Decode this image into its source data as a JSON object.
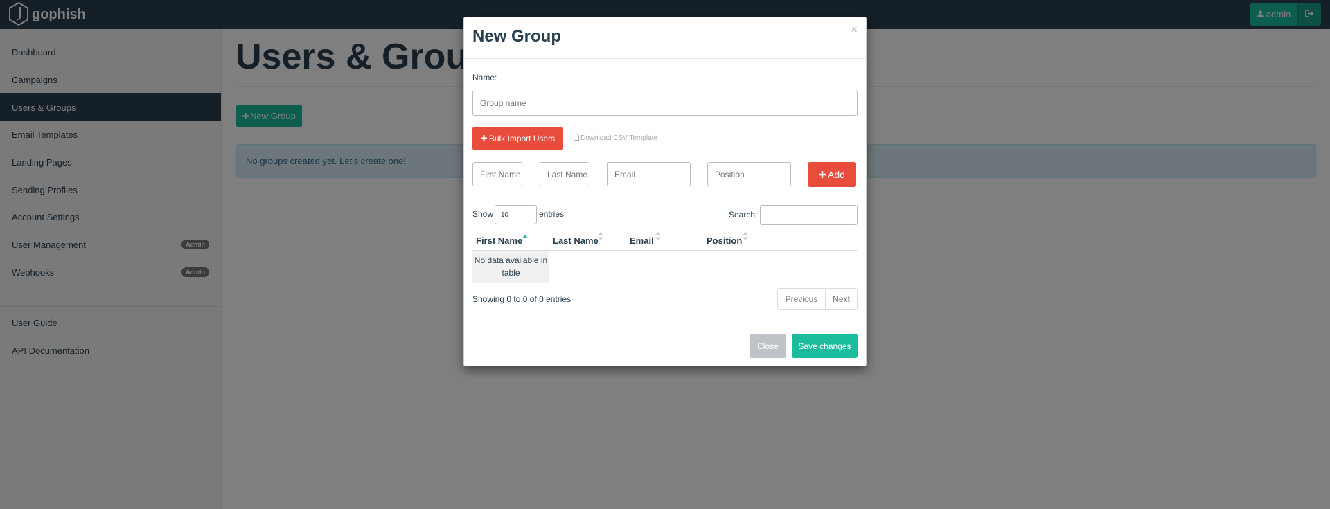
{
  "navbar": {
    "brand": "gophish",
    "user_label": "admin",
    "icons": {
      "logo": "gophish-hexagon-icon",
      "user": "user-icon",
      "logout": "sign-out-icon"
    }
  },
  "sidebar": {
    "items": [
      {
        "label": "Dashboard"
      },
      {
        "label": "Campaigns"
      },
      {
        "label": "Users & Groups",
        "active": true
      },
      {
        "label": "Email Templates"
      },
      {
        "label": "Landing Pages"
      },
      {
        "label": "Sending Profiles"
      },
      {
        "label": "Account Settings"
      },
      {
        "label": "User Management",
        "badge": "Admin"
      },
      {
        "label": "Webhooks",
        "badge": "Admin"
      }
    ],
    "footer_items": [
      {
        "label": "User Guide"
      },
      {
        "label": "API Documentation"
      }
    ]
  },
  "main": {
    "title": "Users & Groups",
    "new_group_label": "New Group",
    "empty_alert": "No groups created yet. Let's create one!"
  },
  "modal": {
    "title": "New Group",
    "close_symbol": "×",
    "name_label": "Name:",
    "group_name_placeholder": "Group name",
    "bulk_import_label": "Bulk Import Users",
    "csv_template_label": "Download CSV Template",
    "fields": {
      "first_name_placeholder": "First Name",
      "last_name_placeholder": "Last Name",
      "email_placeholder": "Email",
      "position_placeholder": "Position"
    },
    "add_label": "Add",
    "table": {
      "show_label": "Show",
      "entries_value": "10",
      "entries_label": "entries",
      "search_label": "Search:",
      "columns": [
        "First Name",
        "Last Name",
        "Email",
        "Position"
      ],
      "empty_message": "No data available in table",
      "info": "Showing 0 to 0 of 0 entries",
      "previous_label": "Previous",
      "next_label": "Next"
    },
    "close_label": "Close",
    "save_label": "Save changes"
  },
  "colors": {
    "navbar": "#283f50",
    "accent": "#1abc9c",
    "danger": "#e74c3c",
    "alert_bg": "#d9edf7"
  }
}
